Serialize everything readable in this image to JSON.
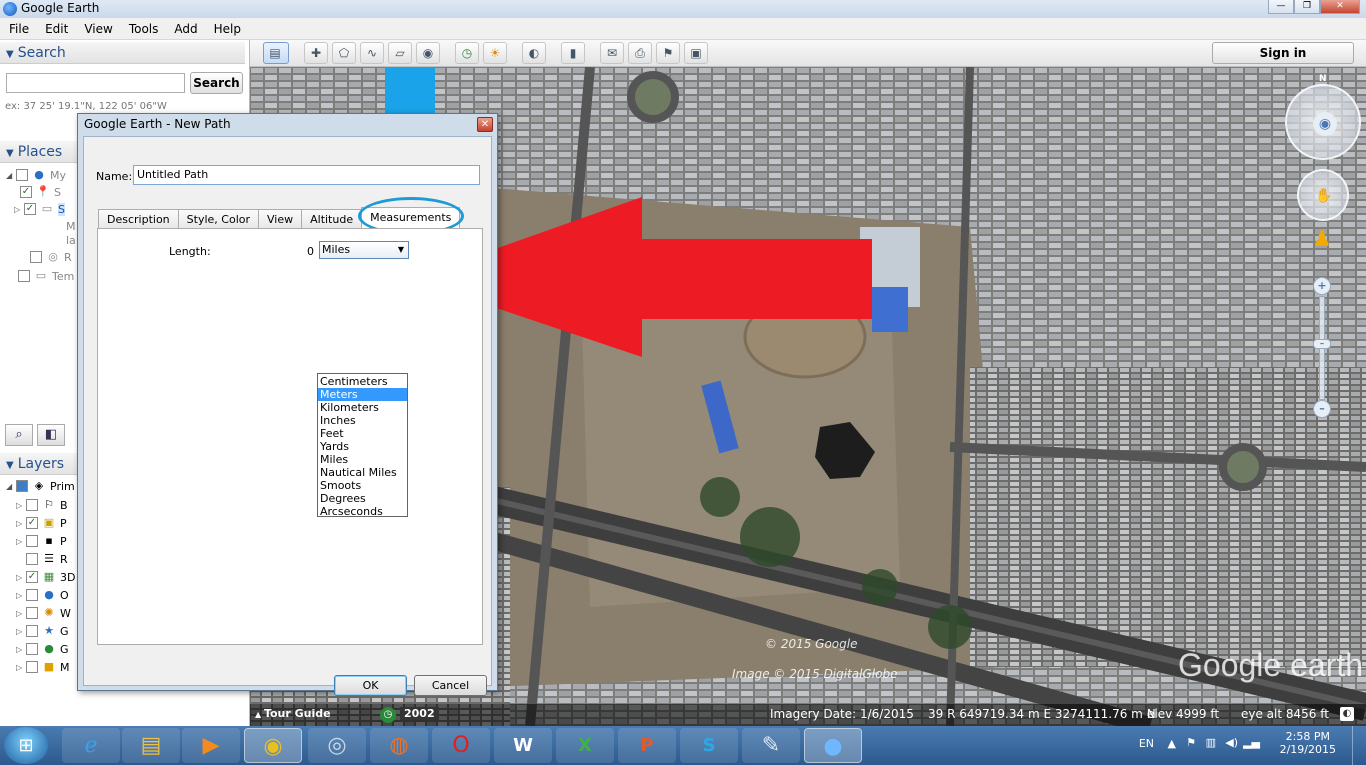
{
  "window": {
    "title": "Google Earth",
    "controls": [
      "—",
      "❐",
      "✕"
    ]
  },
  "menu": [
    "File",
    "Edit",
    "View",
    "Tools",
    "Add",
    "Help"
  ],
  "toolbar": {
    "sign_in": "Sign in"
  },
  "search": {
    "header": "Search",
    "button": "Search",
    "input_value": "",
    "hint": "ex: 37 25' 19.1\"N, 122 05' 06\"W"
  },
  "places": {
    "header": "Places",
    "rows": [
      "My",
      "S",
      "S",
      "M",
      "la",
      "R",
      "Tem"
    ]
  },
  "layers": {
    "header": "Layers",
    "rows": [
      "Prim",
      "B",
      "P",
      "P",
      "R",
      "3D",
      "O",
      "W",
      "G",
      "G",
      "M"
    ]
  },
  "dialog": {
    "title": "Google Earth - New Path",
    "name_label": "Name:",
    "name_value": "Untitled Path",
    "tabs": [
      "Description",
      "Style, Color",
      "View",
      "Altitude",
      "Measurements"
    ],
    "length_label": "Length:",
    "length_value": "0",
    "unit_selected": "Miles",
    "unit_options": [
      "Centimeters",
      "Meters",
      "Kilometers",
      "Inches",
      "Feet",
      "Yards",
      "Miles",
      "Nautical Miles",
      "Smoots",
      "Degrees",
      "Arcseconds"
    ],
    "highlighted_option": "Meters",
    "ok": "OK",
    "cancel": "Cancel"
  },
  "map": {
    "copyright_google": "© 2015 Google",
    "copyright_image": "Image © 2015 DigitalGlobe",
    "logo": "Google earth",
    "compass_n": "N"
  },
  "statusbar": {
    "tour_guide": "Tour Guide",
    "year": "2002",
    "imagery_date": "Imagery Date: 1/6/2015",
    "coords": "39 R 649719.34 m E 3274111.76 m N",
    "elev": "elev  4999 ft",
    "eye_alt": "eye alt  8456 ft"
  },
  "taskbar": {
    "language": "EN",
    "time": "2:58 PM",
    "date": "2/19/2015",
    "apps": [
      "ie-icon",
      "explorer-icon",
      "media-icon",
      "chrome-icon",
      "chrome2-icon",
      "firefox-icon",
      "opera-icon",
      "word-icon",
      "excel-icon",
      "powerpoint-icon",
      "skype-icon",
      "notepad-icon",
      "google-earth-icon"
    ]
  },
  "colors": {
    "blue_arrow": "#1aa3e8",
    "red_arrow": "#ed1c24",
    "highlight": "#3399ff",
    "panel_header": "#25528f"
  }
}
